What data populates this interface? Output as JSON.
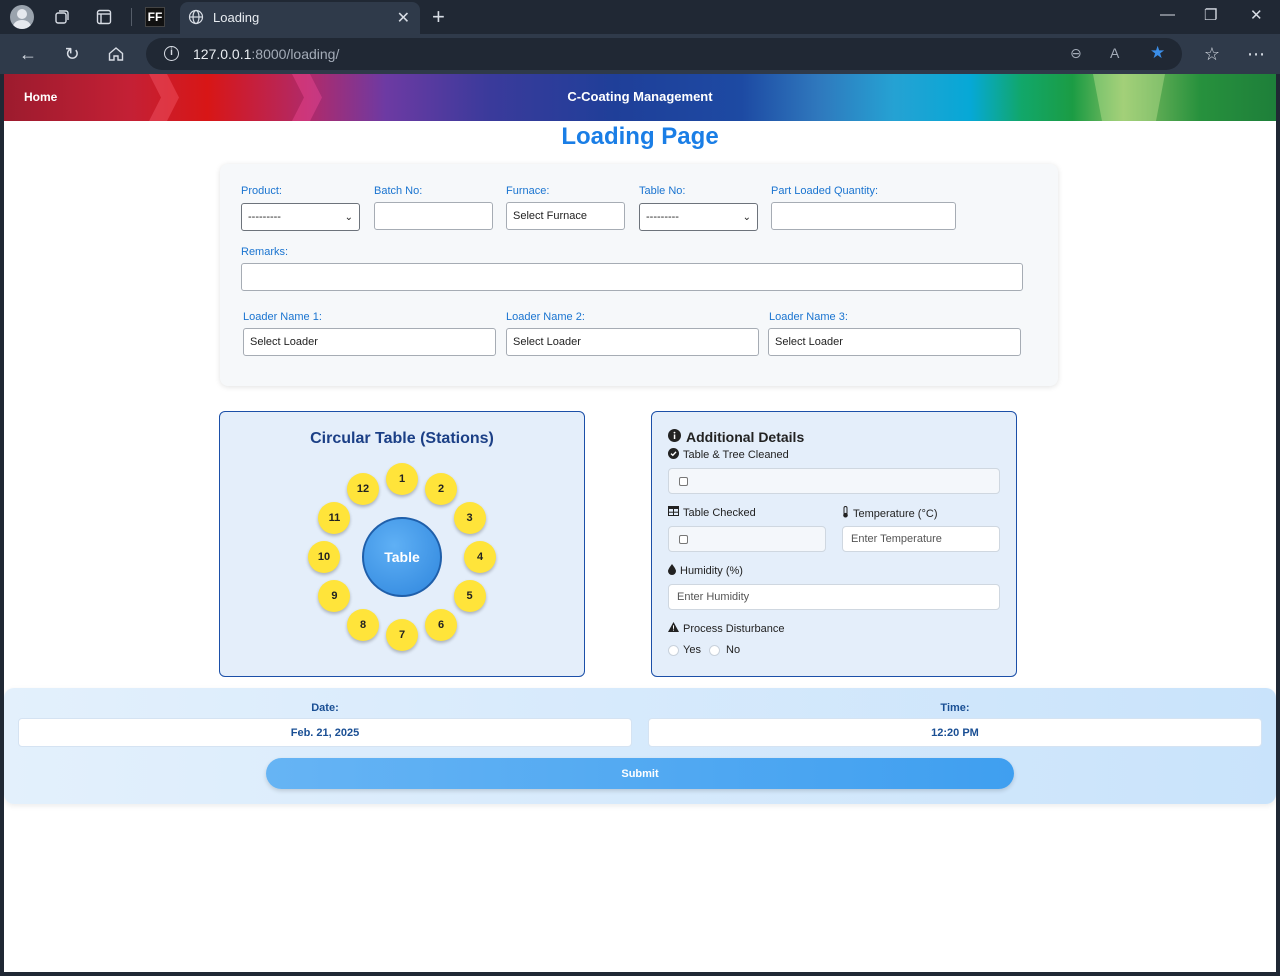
{
  "browser": {
    "tab_title": "Loading",
    "url_host": "127.0.0.1",
    "url_rest": ":8000/loading/",
    "ff_badge": "FF"
  },
  "nav": {
    "home": "Home",
    "brand": "C-Coating Management"
  },
  "page_title": "Loading Page",
  "form": {
    "product_label": "Product:",
    "product_value": "---------",
    "batch_label": "Batch No:",
    "batch_value": "",
    "furnace_label": "Furnace:",
    "furnace_value": "Select Furnace",
    "table_label": "Table No:",
    "table_value": "---------",
    "qty_label": "Part Loaded Quantity:",
    "qty_value": "",
    "remarks_label": "Remarks:",
    "remarks_value": "",
    "loader1_label": "Loader Name 1:",
    "loader1_value": "Select Loader",
    "loader2_label": "Loader Name 2:",
    "loader2_value": "Select Loader",
    "loader3_label": "Loader Name 3:",
    "loader3_value": "Select Loader"
  },
  "circular": {
    "title": "Circular Table (Stations)",
    "center": "Table",
    "stations": [
      "1",
      "2",
      "3",
      "4",
      "5",
      "6",
      "7",
      "8",
      "9",
      "10",
      "11",
      "12"
    ],
    "station_color": "#ffe43a"
  },
  "details": {
    "title": "Additional Details",
    "cleaned_label": "Table & Tree Cleaned",
    "checked_label": "Table Checked",
    "temp_label": "Temperature (°C)",
    "temp_placeholder": "Enter Temperature",
    "humidity_label": "Humidity (%)",
    "humidity_placeholder": "Enter Humidity",
    "disturbance_label": "Process Disturbance",
    "yes": "Yes",
    "no": "No"
  },
  "datetime": {
    "date_label": "Date:",
    "date_value": "Feb. 21, 2025",
    "time_label": "Time:",
    "time_value": "12:20 PM",
    "submit": "Submit"
  }
}
